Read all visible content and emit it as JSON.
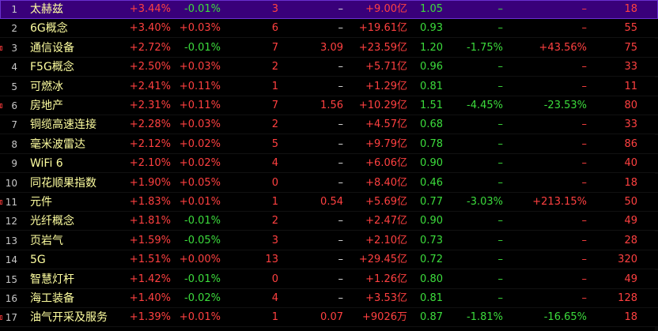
{
  "rows": [
    {
      "n": "1",
      "name": "太赫兹",
      "chg": "+3.44%",
      "cont": "-0.01%",
      "cont_color": "green",
      "cnt": "3",
      "ratio": "–",
      "ratio_color": "white",
      "amt": "+9.00亿",
      "vr": "1.05",
      "p1": "–",
      "p1_color": "green",
      "p2": "–",
      "p2_color": "red",
      "last": "18",
      "mark": false
    },
    {
      "n": "2",
      "name": "6G概念",
      "chg": "+3.40%",
      "cont": "+0.03%",
      "cont_color": "red",
      "cnt": "6",
      "ratio": "–",
      "ratio_color": "white",
      "amt": "+19.61亿",
      "vr": "0.93",
      "p1": "–",
      "p1_color": "green",
      "p2": "–",
      "p2_color": "red",
      "last": "55",
      "mark": false
    },
    {
      "n": "3",
      "name": "通信设备",
      "chg": "+2.72%",
      "cont": "-0.01%",
      "cont_color": "green",
      "cnt": "7",
      "ratio": "3.09",
      "ratio_color": "red",
      "amt": "+23.59亿",
      "vr": "1.20",
      "p1": "-1.75%",
      "p1_color": "green",
      "p2": "+43.56%",
      "p2_color": "red",
      "last": "75",
      "mark": true
    },
    {
      "n": "4",
      "name": "F5G概念",
      "chg": "+2.50%",
      "cont": "+0.03%",
      "cont_color": "red",
      "cnt": "2",
      "ratio": "–",
      "ratio_color": "white",
      "amt": "+5.71亿",
      "vr": "0.96",
      "p1": "–",
      "p1_color": "green",
      "p2": "–",
      "p2_color": "red",
      "last": "33",
      "mark": false
    },
    {
      "n": "5",
      "name": "可燃冰",
      "chg": "+2.41%",
      "cont": "+0.11%",
      "cont_color": "red",
      "cnt": "1",
      "ratio": "–",
      "ratio_color": "white",
      "amt": "+1.29亿",
      "vr": "0.81",
      "p1": "–",
      "p1_color": "green",
      "p2": "–",
      "p2_color": "red",
      "last": "11",
      "mark": false
    },
    {
      "n": "6",
      "name": "房地产",
      "chg": "+2.31%",
      "cont": "+0.11%",
      "cont_color": "red",
      "cnt": "7",
      "ratio": "1.56",
      "ratio_color": "red",
      "amt": "+10.29亿",
      "vr": "1.51",
      "p1": "-4.45%",
      "p1_color": "green",
      "p2": "-23.53%",
      "p2_color": "green",
      "last": "80",
      "mark": true
    },
    {
      "n": "7",
      "name": "铜缆高速连接",
      "chg": "+2.28%",
      "cont": "+0.03%",
      "cont_color": "red",
      "cnt": "2",
      "ratio": "–",
      "ratio_color": "white",
      "amt": "+4.57亿",
      "vr": "0.68",
      "p1": "–",
      "p1_color": "green",
      "p2": "–",
      "p2_color": "red",
      "last": "33",
      "mark": false
    },
    {
      "n": "8",
      "name": "毫米波雷达",
      "chg": "+2.12%",
      "cont": "+0.02%",
      "cont_color": "red",
      "cnt": "5",
      "ratio": "–",
      "ratio_color": "white",
      "amt": "+9.79亿",
      "vr": "0.78",
      "p1": "–",
      "p1_color": "green",
      "p2": "–",
      "p2_color": "red",
      "last": "86",
      "mark": false
    },
    {
      "n": "9",
      "name": "WiFi 6",
      "chg": "+2.10%",
      "cont": "+0.02%",
      "cont_color": "red",
      "cnt": "4",
      "ratio": "–",
      "ratio_color": "white",
      "amt": "+6.06亿",
      "vr": "0.90",
      "p1": "–",
      "p1_color": "green",
      "p2": "–",
      "p2_color": "red",
      "last": "40",
      "mark": false
    },
    {
      "n": "10",
      "name": "同花顺果指数",
      "chg": "+1.90%",
      "cont": "+0.05%",
      "cont_color": "red",
      "cnt": "0",
      "ratio": "–",
      "ratio_color": "white",
      "amt": "+8.40亿",
      "vr": "0.46",
      "p1": "–",
      "p1_color": "green",
      "p2": "–",
      "p2_color": "red",
      "last": "18",
      "mark": false
    },
    {
      "n": "11",
      "name": "元件",
      "chg": "+1.83%",
      "cont": "+0.01%",
      "cont_color": "red",
      "cnt": "1",
      "ratio": "0.54",
      "ratio_color": "red",
      "amt": "+5.69亿",
      "vr": "0.77",
      "p1": "-3.03%",
      "p1_color": "green",
      "p2": "+213.15%",
      "p2_color": "red",
      "last": "50",
      "mark": true
    },
    {
      "n": "12",
      "name": "光纤概念",
      "chg": "+1.81%",
      "cont": "-0.01%",
      "cont_color": "green",
      "cnt": "2",
      "ratio": "–",
      "ratio_color": "white",
      "amt": "+2.47亿",
      "vr": "0.90",
      "p1": "–",
      "p1_color": "green",
      "p2": "–",
      "p2_color": "red",
      "last": "49",
      "mark": false
    },
    {
      "n": "13",
      "name": "页岩气",
      "chg": "+1.59%",
      "cont": "-0.05%",
      "cont_color": "green",
      "cnt": "3",
      "ratio": "–",
      "ratio_color": "white",
      "amt": "+2.10亿",
      "vr": "0.73",
      "p1": "–",
      "p1_color": "green",
      "p2": "–",
      "p2_color": "red",
      "last": "28",
      "mark": false
    },
    {
      "n": "14",
      "name": "5G",
      "chg": "+1.51%",
      "cont": "+0.00%",
      "cont_color": "red",
      "cnt": "13",
      "ratio": "–",
      "ratio_color": "white",
      "amt": "+29.45亿",
      "vr": "0.72",
      "p1": "–",
      "p1_color": "green",
      "p2": "–",
      "p2_color": "red",
      "last": "320",
      "mark": false
    },
    {
      "n": "15",
      "name": "智慧灯杆",
      "chg": "+1.42%",
      "cont": "-0.01%",
      "cont_color": "green",
      "cnt": "0",
      "ratio": "–",
      "ratio_color": "white",
      "amt": "+1.26亿",
      "vr": "0.80",
      "p1": "–",
      "p1_color": "green",
      "p2": "–",
      "p2_color": "red",
      "last": "49",
      "mark": false
    },
    {
      "n": "16",
      "name": "海工装备",
      "chg": "+1.40%",
      "cont": "-0.02%",
      "cont_color": "green",
      "cnt": "4",
      "ratio": "–",
      "ratio_color": "white",
      "amt": "+3.53亿",
      "vr": "0.81",
      "p1": "–",
      "p1_color": "green",
      "p2": "–",
      "p2_color": "red",
      "last": "128",
      "mark": false
    },
    {
      "n": "17",
      "name": "油气开采及服务",
      "chg": "+1.39%",
      "cont": "+0.01%",
      "cont_color": "red",
      "cnt": "1",
      "ratio": "0.07",
      "ratio_color": "red",
      "amt": "+9026万",
      "vr": "0.87",
      "p1": "-1.81%",
      "p1_color": "green",
      "p2": "-16.65%",
      "p2_color": "green",
      "last": "18",
      "mark": true
    }
  ],
  "selected_index": 0
}
